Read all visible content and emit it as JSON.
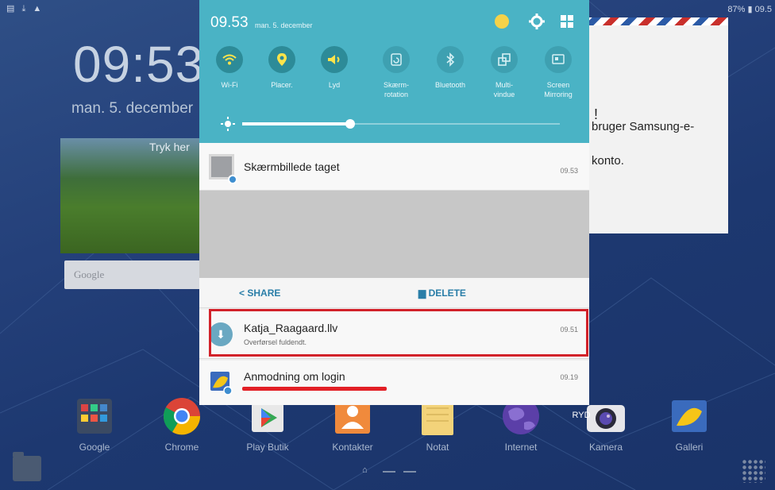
{
  "statusbar": {
    "left_icons": "▤ ⤓ ▲",
    "right_text": "87% ▮ 09.5"
  },
  "widget": {
    "time": "09:53",
    "date": "man. 5. december",
    "tap_text": "Tryk her"
  },
  "background_card": {
    "line1": "!",
    "line2": "bruger Samsung-e-",
    "line3": "konto."
  },
  "google_bar": {
    "placeholder": "Google"
  },
  "dock": {
    "apps": [
      {
        "label": "Google"
      },
      {
        "label": "Chrome"
      },
      {
        "label": "Play Butik"
      },
      {
        "label": "Kontakter"
      },
      {
        "label": "Notat"
      },
      {
        "label": "Internet"
      },
      {
        "label": "Kamera"
      },
      {
        "label": "Galleri"
      }
    ],
    "ryd_label": "RYD"
  },
  "quick_settings": {
    "time": "09.53",
    "date": "man. 5. december",
    "tiles": [
      {
        "label": "Wi-Fi",
        "icon": "wifi-icon",
        "state": "on"
      },
      {
        "label": "Placer.",
        "icon": "location-icon",
        "state": "on"
      },
      {
        "label": "Lyd",
        "icon": "volume-icon",
        "state": "on"
      },
      {
        "label": "Skærm-\nrotation",
        "icon": "rotation-icon",
        "state": "off"
      },
      {
        "label": "Bluetooth",
        "icon": "bluetooth-icon",
        "state": "off"
      },
      {
        "label": "Multi-\nvindue",
        "icon": "multiwindow-icon",
        "state": "off"
      },
      {
        "label": "Screen\nMirroring",
        "icon": "screen-mirroring-icon",
        "state": "off"
      }
    ],
    "brightness_level": 0.34
  },
  "notifications": {
    "screenshot": {
      "title": "Skærmbillede taget",
      "time": "09.53",
      "share_label": "SHARE",
      "delete_label": "DELETE"
    },
    "download": {
      "title": "Katja_Raagaard.llv",
      "subtitle": "Overførsel fuldendt.",
      "time": "09.51"
    },
    "login": {
      "title": "Anmodning om login",
      "time": "09.19"
    }
  },
  "colors": {
    "qs_background": "#4ab3c5",
    "highlight": "#d2222a",
    "action": "#2a7ea8"
  }
}
